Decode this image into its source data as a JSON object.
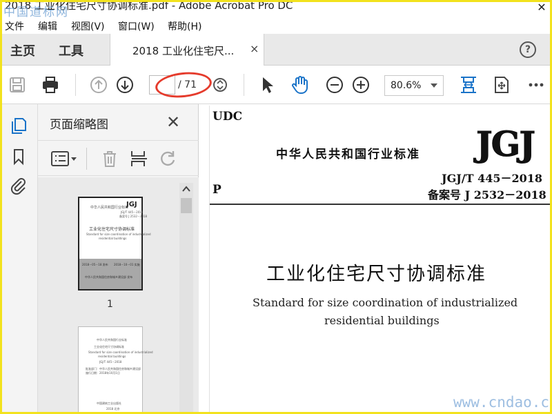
{
  "window": {
    "title": "2018 工业化住宅尺寸协调标准.pdf - Adobe Acrobat Pro DC",
    "watermark_top": "中国道标网",
    "close_glyph": "✕"
  },
  "menu": [
    "文件",
    "编辑",
    "视图(V)",
    "窗口(W)",
    "帮助(H)"
  ],
  "tabs": {
    "home": "主页",
    "tools": "工具",
    "doc": "2018 工业化住宅尺...",
    "doc_close": "×",
    "help": "?"
  },
  "toolbar": {
    "page_current": "",
    "page_total": "/ 71",
    "zoom": "80.6%",
    "accent_color": "#1a73c8"
  },
  "thumbnails": {
    "title": "页面缩略图",
    "close": "✕",
    "page1_label": "1"
  },
  "document": {
    "udc": "UDC",
    "standard_cn": "中华人民共和国行业标准",
    "logo": "JGJ",
    "code": "JGJ/T 445－2018",
    "record": "备案号 J 2532－2018",
    "p": "P",
    "title_cn": "工业化住宅尺寸协调标准",
    "title_en_1": "Standard for size coordination of industrialized",
    "title_en_2": "residential buildings"
  },
  "watermark_bottom": "www.cndao.com"
}
